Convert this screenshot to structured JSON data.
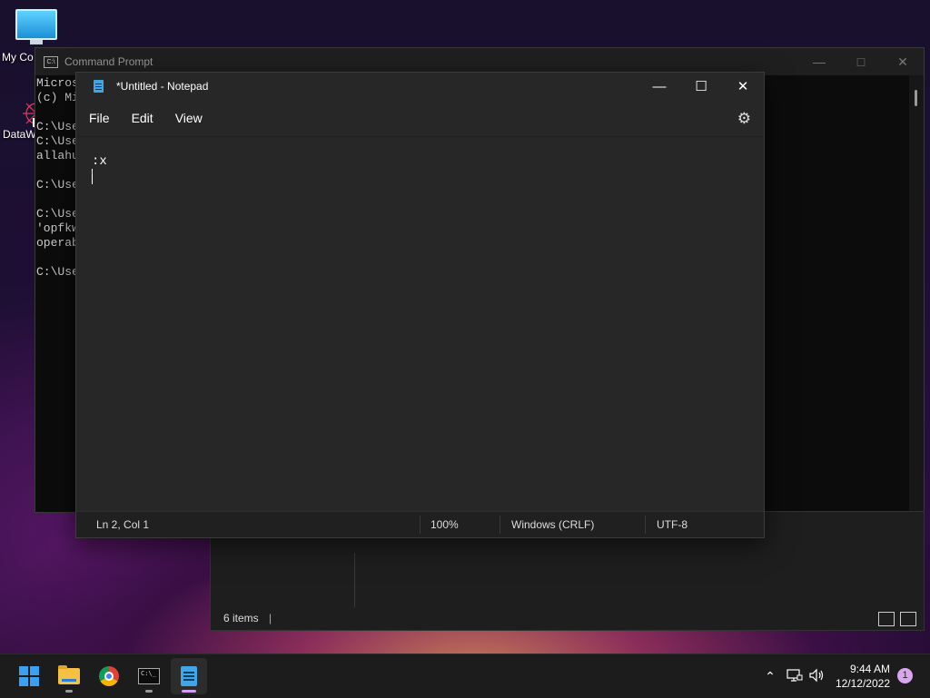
{
  "desktop": {
    "icons": [
      {
        "label": "My Co",
        "icon": "computer-icon"
      },
      {
        "label": "DataW",
        "icon": "datawrapper-icon"
      }
    ]
  },
  "cmd": {
    "title": "Command Prompt",
    "lines": [
      "Micros",
      "(c) Mi",
      "",
      "C:\\Use",
      "C:\\Use",
      "allahu",
      "",
      "C:\\Use",
      "",
      "C:\\Use",
      "'opfkw",
      "operab",
      "",
      "C:\\Use"
    ]
  },
  "explorer": {
    "status": "6 items"
  },
  "notepad": {
    "title": "*Untitled - Notepad",
    "menu": {
      "file": "File",
      "edit": "Edit",
      "view": "View"
    },
    "content": ":x",
    "status": {
      "position": "Ln 2, Col 1",
      "zoom": "100%",
      "line_ending": "Windows (CRLF)",
      "encoding": "UTF-8"
    }
  },
  "taskbar": {
    "apps": [
      "start-icon",
      "file-explorer-icon",
      "chrome-icon",
      "command-prompt-icon",
      "notepad-icon"
    ],
    "time": "9:44 AM",
    "date": "12/12/2022",
    "notifications": "1"
  }
}
